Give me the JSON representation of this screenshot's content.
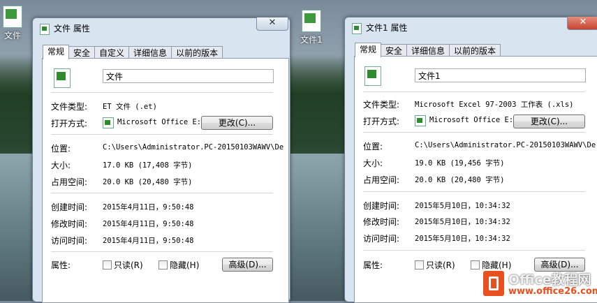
{
  "desktop": {
    "icon1_label": "文件",
    "icon2_label": "文件1"
  },
  "common": {
    "tabs_left": [
      "常规",
      "安全",
      "自定义",
      "详细信息",
      "以前的版本"
    ],
    "tabs_right": [
      "常规",
      "安全",
      "详细信息",
      "以前的版本"
    ],
    "label_type": "文件类型:",
    "label_open": "打开方式:",
    "label_location": "位置:",
    "label_size": "大小:",
    "label_disk": "占用空间:",
    "label_created": "创建时间:",
    "label_modified": "修改时间:",
    "label_accessed": "访问时间:",
    "label_attributes": "属性:",
    "change_button": "更改(C)...",
    "readonly": "只读(R)",
    "hidden": "隐藏(H)",
    "advanced_button": "高级(D)...",
    "close_icon": "✕"
  },
  "left": {
    "title": "文件 属性",
    "filename": "文件",
    "type": "ET 文件 (.et)",
    "open_with": "Microsoft Office E:",
    "location": "C:\\Users\\Administrator.PC-20150103WAWV\\De",
    "size": "17.0 KB (17,408 字节)",
    "disk": "20.0 KB (20,480 字节)",
    "created": "2015年4月11日，9:50:48",
    "modified": "2015年4月11日，9:50:48",
    "accessed": "2015年4月11日，9:50:48"
  },
  "right": {
    "title": "文件1 属性",
    "filename": "文件1",
    "type": "Microsoft Excel 97-2003 工作表 (.xls)",
    "open_with": "Microsoft Office E:",
    "location": "C:\\Users\\Administrator.PC-20150103WAWV\\De",
    "size": "19.0 KB (19,456 字节)",
    "disk": "20.0 KB (20,480 字节)",
    "created": "2015年5月10日，10:34:32",
    "modified": "2015年5月10日，10:34:32",
    "accessed": "2015年5月10日，10:34:32"
  },
  "watermark": {
    "line1": "Office教程网",
    "line2": "www.office26.com"
  }
}
